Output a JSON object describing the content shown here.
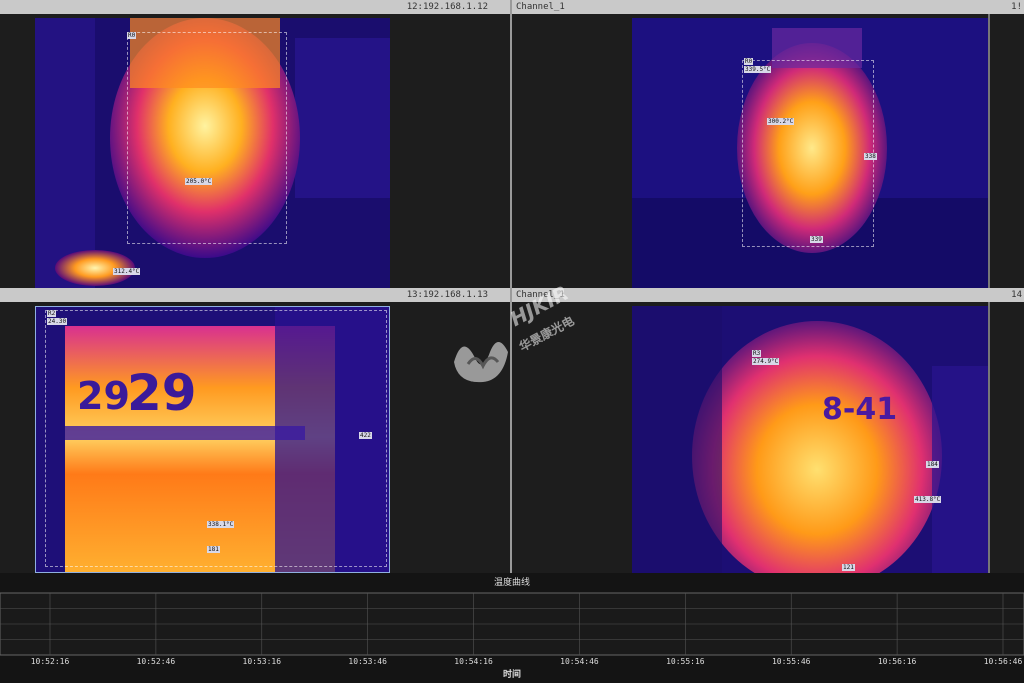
{
  "panes": [
    {
      "ip": "12:192.168.1.12",
      "channel": ""
    },
    {
      "ip": "",
      "channel": "Channel_1",
      "edge": "1!"
    },
    {
      "ip": "13:192.168.1.13",
      "channel": ""
    },
    {
      "ip": "",
      "channel": "Channel_1",
      "edge": "14"
    }
  ],
  "tags": {
    "p1": {
      "r0": "R0",
      "spot": "205.0°C",
      "hot": "312.4°C"
    },
    "p2": {
      "r0": "R0",
      "r0v": "339.5°C",
      "mid": "300.2°C",
      "side": "338",
      "bot": "339"
    },
    "p3": {
      "r2": "R2",
      "r2v": "24.30",
      "side": "422",
      "mid": "338.1°C",
      "bot": "181"
    },
    "p4": {
      "r3": "R3",
      "r3v": "274.9°C",
      "side": "184",
      "mid": "413.8°C",
      "bot": "121"
    }
  },
  "numbers": {
    "p3_a": "29",
    "p3_b": "29",
    "p4_a": "8-41"
  },
  "watermark": {
    "brand": "HJKIR",
    "cn": "华景康光电"
  },
  "chart_data": {
    "type": "line",
    "title": "温度曲线",
    "xlabel": "时间",
    "ticks": [
      "10:52:16",
      "10:52:46",
      "10:53:16",
      "10:53:46",
      "10:54:16",
      "10:54:46",
      "10:55:16",
      "10:55:46",
      "10:56:16",
      "10:56:46"
    ],
    "grid": true,
    "series": []
  },
  "colors": {
    "accent": "#8fb0e0",
    "panel": "#1d1d1d",
    "header": "#c9c9c9"
  }
}
